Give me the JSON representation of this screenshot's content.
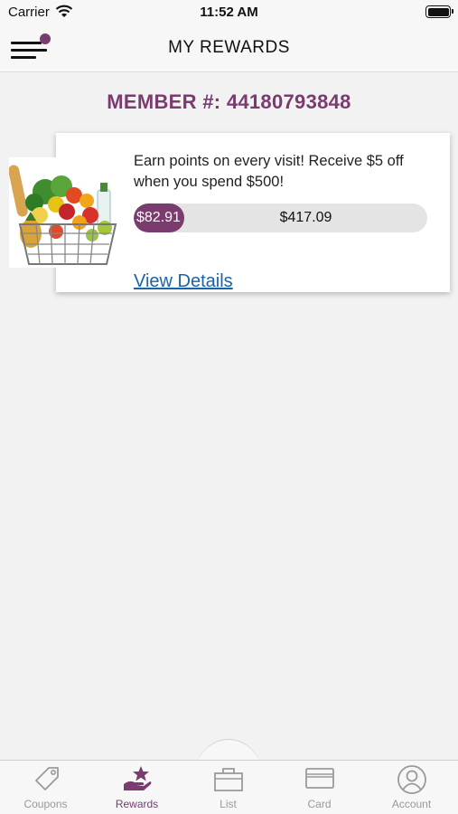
{
  "status_bar": {
    "carrier": "Carrier",
    "time": "11:52 AM"
  },
  "header": {
    "title": "MY REWARDS"
  },
  "member": {
    "label": "MEMBER #: 44180793848"
  },
  "reward": {
    "description": "Earn points on every visit! Receive $5 off when you spend $500!",
    "earned": "$82.91",
    "remaining": "$417.09",
    "progress_fraction": 0.166,
    "link_label": "View Details",
    "image_icon": "grocery-basket"
  },
  "tab_bar": {
    "tabs": [
      {
        "label": "Coupons",
        "icon": "tag-icon",
        "active": false
      },
      {
        "label": "Rewards",
        "icon": "star-hand-icon",
        "active": true
      },
      {
        "label": "List",
        "icon": "basket-icon",
        "active": false
      },
      {
        "label": "Card",
        "icon": "card-icon",
        "active": false
      },
      {
        "label": "Account",
        "icon": "user-icon",
        "active": false
      }
    ]
  },
  "colors": {
    "accent": "#7a3b6f",
    "link": "#1a63a8",
    "inactive_tab": "#999999"
  }
}
